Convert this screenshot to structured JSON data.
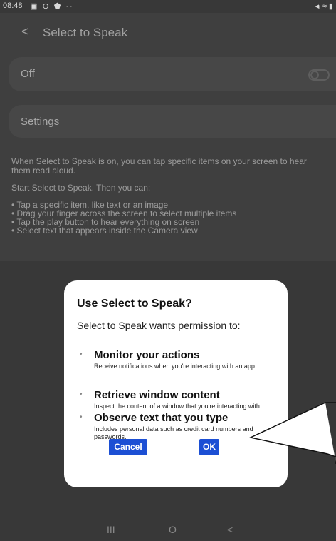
{
  "status": {
    "time": "08:48",
    "left_icons": "▣ ⊖ ⬟ ··",
    "right_icons": "◂ᵢ ≈ ▮"
  },
  "appbar": {
    "back_glyph": "<",
    "title": "Select to Speak"
  },
  "toggle_row": {
    "label": "Off",
    "state": "off"
  },
  "settings_row": {
    "label": "Settings"
  },
  "description": {
    "p1": "When Select to Speak is on, you can tap specific items on your screen to hear them read aloud.",
    "p2": "Start Select to Speak. Then you can:",
    "bullets": [
      "Tap a specific item, like text or an image",
      "Drag your finger across the screen to select multiple items",
      "Tap the play button to hear everything on screen",
      "Select text that appears inside the Camera view"
    ]
  },
  "dialog": {
    "title": "Use Select to Speak?",
    "subtitle": "Select to Speak wants permission to:",
    "permissions": [
      {
        "title": "Monitor your actions",
        "desc": "Receive notifications when you're interacting with an app."
      },
      {
        "title": "Retrieve window content",
        "desc": "Inspect the content of a window that you're interacting with."
      },
      {
        "title": "Observe text that you type",
        "desc": "Includes personal data such as credit card numbers and passwords."
      }
    ],
    "cancel_label": "Cancel",
    "ok_label": "OK",
    "accent": "#1c4fd4"
  },
  "navbar": {
    "recents": "III",
    "home": "O",
    "back": "<"
  }
}
